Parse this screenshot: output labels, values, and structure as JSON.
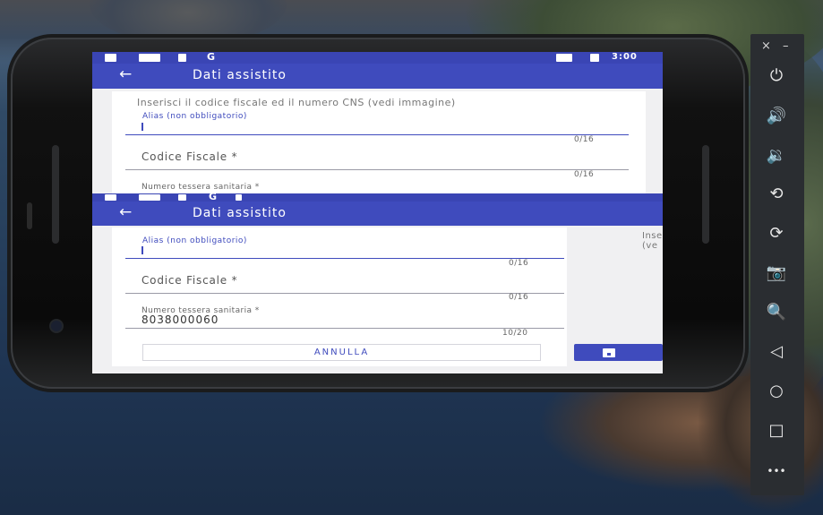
{
  "emulator": {
    "close_label": "×",
    "minimize_label": "–",
    "buttons": [
      {
        "name": "power-icon",
        "glyph": "⏻"
      },
      {
        "name": "volume-up-icon",
        "glyph": "🔊"
      },
      {
        "name": "volume-down-icon",
        "glyph": "🔉"
      },
      {
        "name": "rotate-left-icon",
        "glyph": "⟲"
      },
      {
        "name": "rotate-right-icon",
        "glyph": "⟳"
      },
      {
        "name": "camera-icon",
        "glyph": "📷"
      },
      {
        "name": "zoom-icon",
        "glyph": "🔍"
      },
      {
        "name": "back-icon",
        "glyph": "◁"
      },
      {
        "name": "home-icon",
        "glyph": "○"
      },
      {
        "name": "overview-icon",
        "glyph": "□"
      },
      {
        "name": "more-icon",
        "glyph": "•••"
      }
    ]
  },
  "statusbar": {
    "g_label": "G",
    "time": "3:00"
  },
  "appbar": {
    "back_glyph": "←",
    "title": "Dati assistito"
  },
  "form_top": {
    "instruction": "Inserisci il codice fiscale ed il numero CNS (vedi immagine)",
    "alias_label": "Alias (non obbligatorio)",
    "alias_counter": "0/16",
    "cf_placeholder": "Codice Fiscale *",
    "cf_counter": "0/16",
    "tessera_label": "Numero tessera sanitaria *"
  },
  "form_bottom": {
    "alias_label": "Alias (non obbligatorio)",
    "alias_counter": "0/16",
    "cf_placeholder": "Codice Fiscale *",
    "cf_counter": "0/16",
    "tessera_label": "Numero tessera sanitaria *",
    "tessera_value": "8038000060",
    "tessera_counter": "10/20",
    "side_text_1": "Inse",
    "side_text_2": "(ve",
    "cancel_label": "ANNULLA"
  },
  "colors": {
    "primary": "#3f4bbd",
    "status": "#3a45b4"
  }
}
